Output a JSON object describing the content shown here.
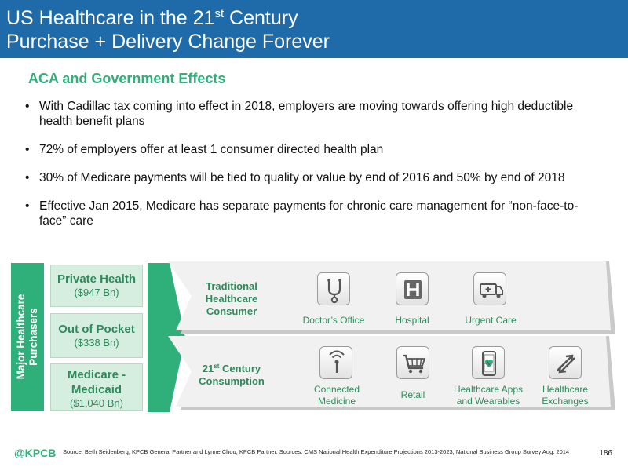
{
  "header": {
    "line1_pre": "US Healthcare in the 21",
    "line1_sup": "st",
    "line1_post": " Century",
    "line2": "Purchase + Delivery Change Forever"
  },
  "section_heading": "ACA and Government Effects",
  "bullets": [
    "With Cadillac tax coming into effect in 2018, employers are moving towards offering high deductible health benefit plans",
    "72% of employers offer at least 1 consumer directed health plan",
    "30% of Medicare payments will be tied to quality or value by end of 2016 and 50% by end of 2018",
    "Effective Jan 2015, Medicare has separate payments for chronic care management for “non-face-to-face” care"
  ],
  "purchasers": {
    "label_line1": "Major Healthcare",
    "label_line2": "Purchasers",
    "items": [
      {
        "name": "Private Health",
        "value": "($947 Bn)"
      },
      {
        "name": "Out of Pocket",
        "value": "($338 Bn)"
      },
      {
        "name_line1": "Medicare -",
        "name_line2": "Medicaid",
        "value": "($1,040 Bn)"
      }
    ]
  },
  "traditional": {
    "label_line1": "Traditional",
    "label_line2": "Healthcare",
    "label_line3": "Consumer",
    "items": [
      {
        "caption": "Doctor’s Office",
        "icon": "stethoscope-icon"
      },
      {
        "caption": "Hospital",
        "icon": "hospital-icon"
      },
      {
        "caption": "Urgent Care",
        "icon": "ambulance-icon"
      }
    ]
  },
  "modern": {
    "label_pre": "21",
    "label_sup": "st",
    "label_post": " Century",
    "label_line2": "Consumption",
    "items": [
      {
        "caption_line1": "Connected",
        "caption_line2": "Medicine",
        "icon": "signal-icon"
      },
      {
        "caption_line1": "Retail",
        "caption_line2": "",
        "icon": "shopping-cart-icon"
      },
      {
        "caption_line1": "Healthcare Apps",
        "caption_line2": "and Wearables",
        "icon": "smartphone-heart-icon"
      },
      {
        "caption_line1": "Healthcare",
        "caption_line2": "Exchanges",
        "icon": "exchange-arrows-icon"
      }
    ]
  },
  "footer": {
    "logo": "@KPCB",
    "source": "Source: Beth Seidenberg, KPCB General Partner and Lynne Chou, KPCB Partner. Sources: CMS National Health Expenditure Projections 2013-2023, National Business Group Survey Aug. 2014",
    "page_number": "186"
  },
  "colors": {
    "header_blue": "#1f6aa8",
    "accent_green": "#2fb07a",
    "label_green": "#2e8a5c",
    "box_green": "#d6eedf"
  }
}
